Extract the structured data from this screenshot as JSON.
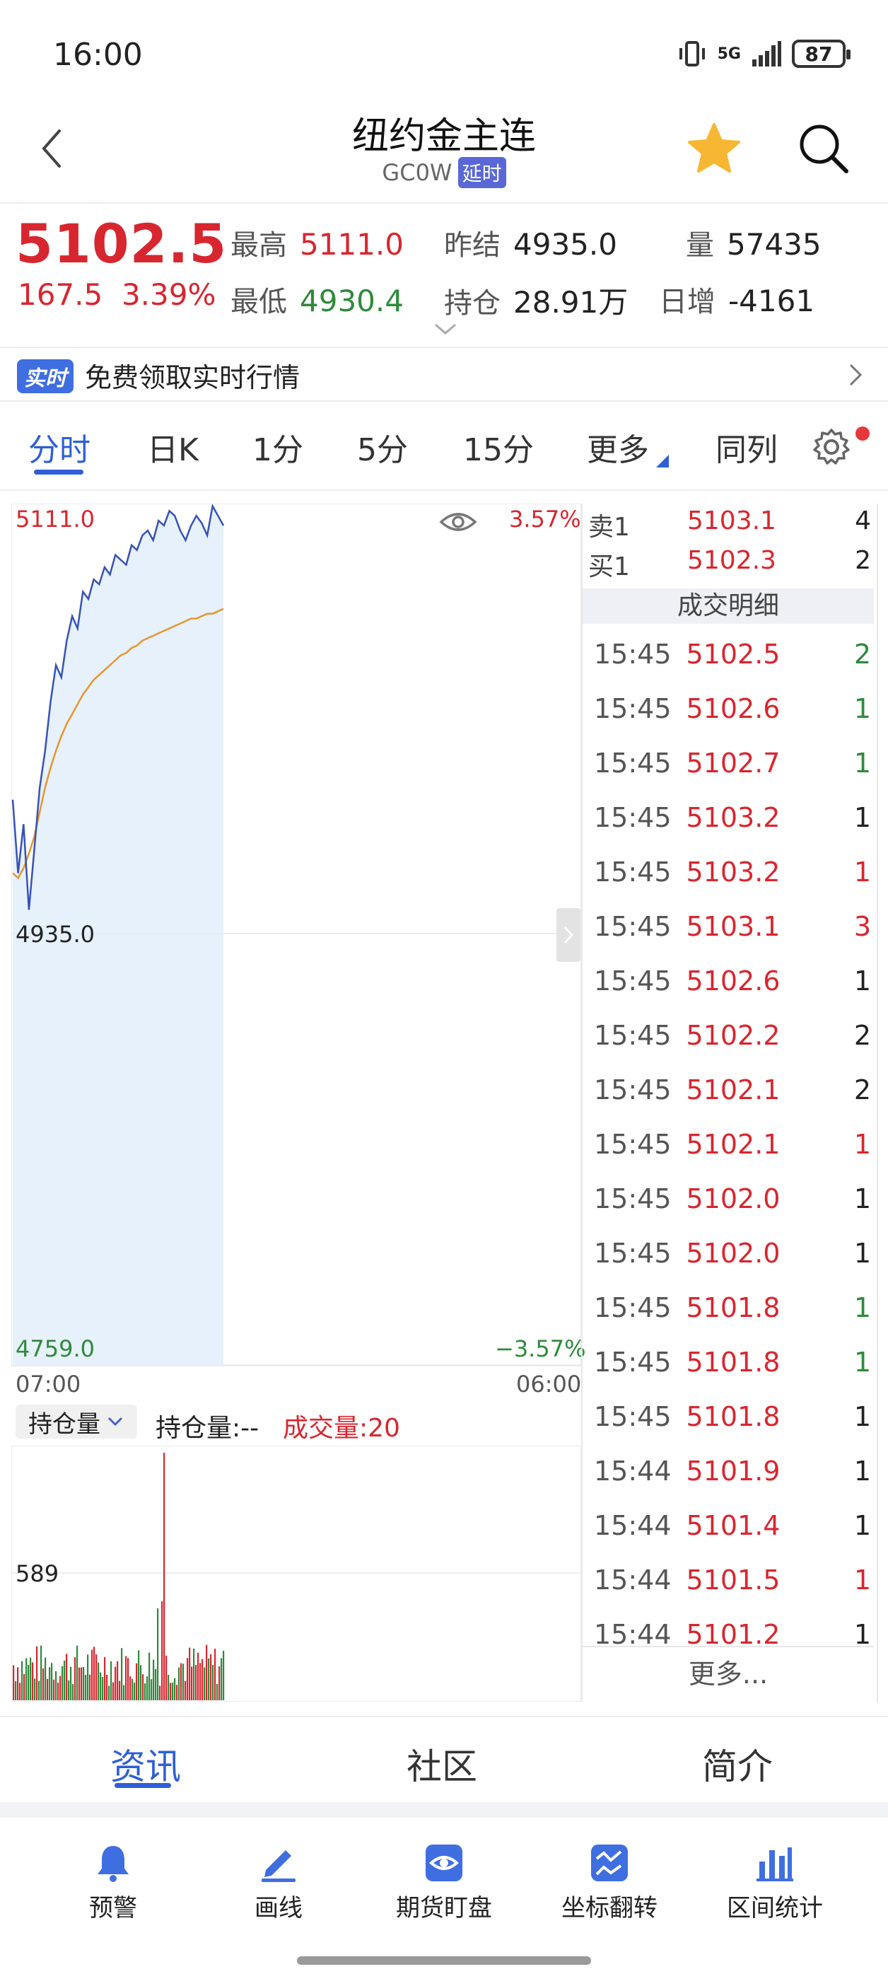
{
  "status_bar": {
    "time": "16:00",
    "network": "5G",
    "battery": "87"
  },
  "header": {
    "title": "纽约金主连",
    "code": "GC0W",
    "delay_badge": "延时"
  },
  "quote": {
    "last": "5102.5",
    "change": "167.5",
    "change_pct": "3.39%",
    "high_label": "最高",
    "high": "5111.0",
    "low_label": "最低",
    "low": "4930.4",
    "prev_settle_label": "昨结",
    "prev_settle": "4935.0",
    "open_interest_label": "持仓",
    "open_interest": "28.91万",
    "volume_label": "量",
    "volume": "57435",
    "daily_inc_label": "日增",
    "daily_inc": "-4161"
  },
  "promo": {
    "badge": "实时",
    "text": "免费领取实时行情"
  },
  "tabs": [
    {
      "label": "分时",
      "active": true
    },
    {
      "label": "日K"
    },
    {
      "label": "1分"
    },
    {
      "label": "5分"
    },
    {
      "label": "15分"
    },
    {
      "label": "更多"
    },
    {
      "label": "同列"
    }
  ],
  "chart_data": {
    "type": "line",
    "y_top": "5111.0",
    "y_mid": "4935.0",
    "y_bottom": "4759.0",
    "pct_top": "3.57%",
    "pct_bottom": "−3.57%",
    "x_start": "07:00",
    "x_end": "06:00",
    "ylim": [
      4759.0,
      5111.0
    ],
    "price_series": [
      4990,
      4960,
      4980,
      4945,
      4970,
      4995,
      5010,
      5030,
      5045,
      5040,
      5055,
      5065,
      5060,
      5075,
      5072,
      5080,
      5078,
      5085,
      5082,
      5090,
      5088,
      5086,
      5094,
      5092,
      5098,
      5100,
      5096,
      5104,
      5102,
      5108,
      5106,
      5100,
      5096,
      5102,
      5106,
      5103,
      5098,
      5110,
      5106,
      5102
    ],
    "avg_series": [
      4960,
      4958,
      4962,
      4968,
      4975,
      4985,
      4995,
      5003,
      5010,
      5016,
      5021,
      5025,
      5029,
      5033,
      5036,
      5039,
      5041,
      5043,
      5045,
      5047,
      5049,
      5050,
      5052,
      5053,
      5055,
      5056,
      5057,
      5058,
      5059,
      5060,
      5061,
      5062,
      5063,
      5064,
      5064,
      5065,
      5066,
      5066,
      5067,
      5068
    ],
    "volume_max_label": "589"
  },
  "indicator": {
    "select_label": "持仓量",
    "open_interest_text": "持仓量:--",
    "volume_text": "成交量:20"
  },
  "order_book": [
    {
      "label": "卖1",
      "price": "5103.1",
      "qty": "4"
    },
    {
      "label": "买1",
      "price": "5102.3",
      "qty": "2"
    }
  ],
  "trade_detail_title": "成交明细",
  "trades": [
    {
      "time": "15:45",
      "price": "5102.5",
      "qty": "2",
      "qcolor": "#2f8a3b"
    },
    {
      "time": "15:45",
      "price": "5102.6",
      "qty": "1",
      "qcolor": "#2f8a3b"
    },
    {
      "time": "15:45",
      "price": "5102.7",
      "qty": "1",
      "qcolor": "#2f8a3b"
    },
    {
      "time": "15:45",
      "price": "5103.2",
      "qty": "1",
      "qcolor": "#222222"
    },
    {
      "time": "15:45",
      "price": "5103.2",
      "qty": "1",
      "qcolor": "#d8262f"
    },
    {
      "time": "15:45",
      "price": "5103.1",
      "qty": "3",
      "qcolor": "#d8262f"
    },
    {
      "time": "15:45",
      "price": "5102.6",
      "qty": "1",
      "qcolor": "#222222"
    },
    {
      "time": "15:45",
      "price": "5102.2",
      "qty": "2",
      "qcolor": "#222222"
    },
    {
      "time": "15:45",
      "price": "5102.1",
      "qty": "2",
      "qcolor": "#222222"
    },
    {
      "time": "15:45",
      "price": "5102.1",
      "qty": "1",
      "qcolor": "#d8262f"
    },
    {
      "time": "15:45",
      "price": "5102.0",
      "qty": "1",
      "qcolor": "#222222"
    },
    {
      "time": "15:45",
      "price": "5102.0",
      "qty": "1",
      "qcolor": "#222222"
    },
    {
      "time": "15:45",
      "price": "5101.8",
      "qty": "1",
      "qcolor": "#2f8a3b"
    },
    {
      "time": "15:45",
      "price": "5101.8",
      "qty": "1",
      "qcolor": "#2f8a3b"
    },
    {
      "time": "15:45",
      "price": "5101.8",
      "qty": "1",
      "qcolor": "#222222"
    },
    {
      "time": "15:44",
      "price": "5101.9",
      "qty": "1",
      "qcolor": "#222222"
    },
    {
      "time": "15:44",
      "price": "5101.4",
      "qty": "1",
      "qcolor": "#222222"
    },
    {
      "time": "15:44",
      "price": "5101.5",
      "qty": "1",
      "qcolor": "#d8262f"
    },
    {
      "time": "15:44",
      "price": "5101.2",
      "qty": "1",
      "qcolor": "#222222"
    }
  ],
  "more_trades": "更多...",
  "bottom_tabs": [
    {
      "label": "资讯",
      "active": true
    },
    {
      "label": "社区"
    },
    {
      "label": "简介"
    }
  ],
  "toolbar": [
    {
      "label": "预警",
      "icon": "bell-icon"
    },
    {
      "label": "画线",
      "icon": "pen-line-icon"
    },
    {
      "label": "期货盯盘",
      "icon": "eye-icon"
    },
    {
      "label": "坐标翻转",
      "icon": "flip-icon"
    },
    {
      "label": "区间统计",
      "icon": "bar-stats-icon"
    }
  ],
  "colors": {
    "accent": "#2f5fd6",
    "up": "#d8262f",
    "down": "#2f8a3b"
  }
}
